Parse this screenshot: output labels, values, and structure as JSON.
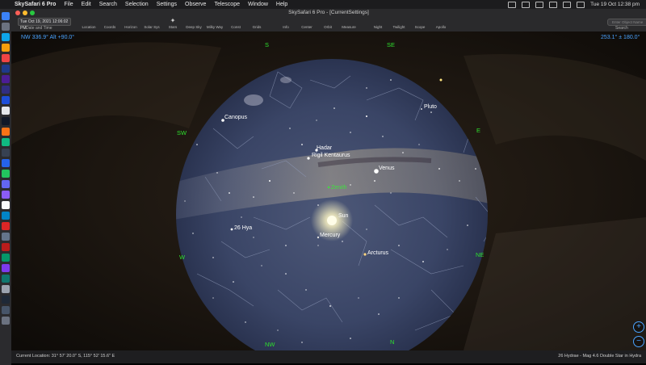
{
  "menubar": {
    "app": "SkySafari 6 Pro",
    "items": [
      "File",
      "Edit",
      "Search",
      "Selection",
      "Settings",
      "Observe",
      "Telescope",
      "Window",
      "Help"
    ],
    "clock": "Tue 19 Oct 12:38 pm"
  },
  "window": {
    "title": "SkySafari 6 Pro - [CurrentSettings]"
  },
  "toolbar": {
    "date_value": "Tue Oct 19, 2021 12:06:02 PM",
    "date_label": "Date and Time",
    "tools": [
      "Location",
      "Coords",
      "Horizon",
      "Solar Sys",
      "Stars",
      "Deep Sky",
      "Milky Way",
      "Const",
      "Grids",
      "Info",
      "Center",
      "Orbit",
      "Measure",
      "Night",
      "Twilight",
      "Scope",
      "Apollo"
    ],
    "search_placeholder": "Enter Object Name",
    "search_label": "Search"
  },
  "sky": {
    "coord_left": "NW 336.9° Alt +90.0°",
    "coord_right": "253.1° ± 180.0°",
    "directions": [
      "S",
      "SE",
      "E",
      "NE",
      "N",
      "NW",
      "W",
      "SW"
    ],
    "labels": {
      "canopus": "Canopus",
      "pluto": "Pluto",
      "hadar": "Hadar",
      "rigil": "Rigil Kentaurus",
      "venus": "Venus",
      "zenith": "Zenith",
      "sun": "Sun",
      "mercury": "Mercury",
      "hya": "26 Hya",
      "arcturus": "Arcturus"
    }
  },
  "statusbar": {
    "location": "Current Location: 31° 57' 20.0\" S, 115° 52' 15.6\" E",
    "selection": "26 Hydrae - Mag 4.6 Double Star in Hydra"
  },
  "colors": {
    "accent_blue": "#4aa3ff",
    "direction_green": "#2ee02e",
    "sky_blue": "#3a4566"
  }
}
